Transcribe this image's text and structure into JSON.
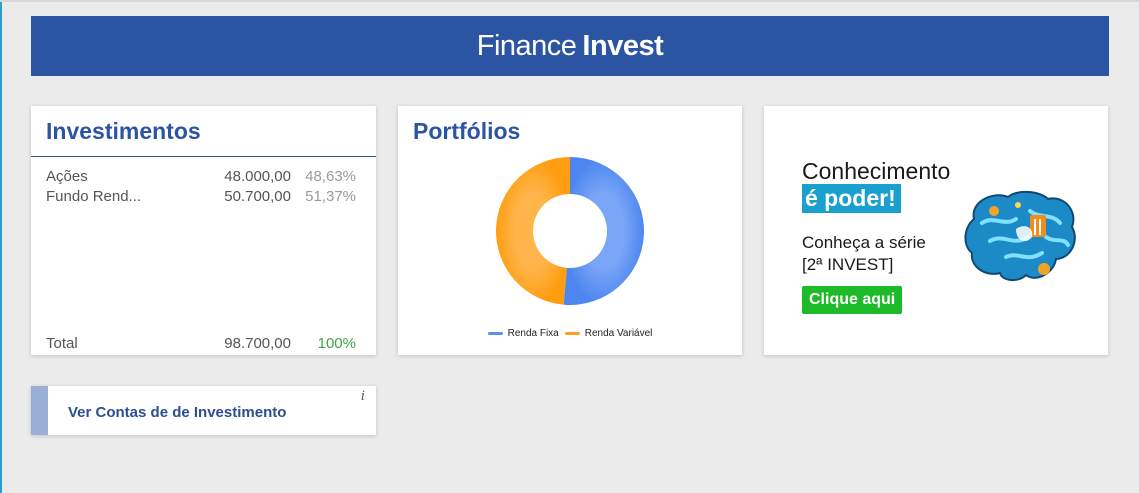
{
  "header": {
    "brand_light": "Finance",
    "brand_bold": "Invest"
  },
  "investments": {
    "title": "Investimentos",
    "rows": [
      {
        "name": "Ações",
        "value": "48.000,00",
        "pct": "48,63%"
      },
      {
        "name": "Fundo Rend...",
        "value": "50.700,00",
        "pct": "51,37%"
      }
    ],
    "total": {
      "name": "Total",
      "value": "98.700,00",
      "pct": "100%"
    }
  },
  "portfolios": {
    "title": "Portfólios",
    "legend": [
      {
        "label": "Renda Fixa",
        "color": "#5b8ff0"
      },
      {
        "label": "Renda Variável",
        "color": "#ffa11f"
      }
    ],
    "chart_data": {
      "type": "pie",
      "categories": [
        "Renda Fixa",
        "Renda Variável"
      ],
      "values": [
        51.37,
        48.63
      ],
      "donut": true,
      "legend": "bottom"
    }
  },
  "ad": {
    "line1": "Conhecimento",
    "line2": "é poder!",
    "line3": "Conheça a série",
    "line4": "[2ª INVEST]",
    "cta": "Clique aqui",
    "image_icon": "brain-icon",
    "colors": {
      "highlight": "#1aa0cf",
      "cta": "#1dbb29"
    }
  },
  "accounts_link": {
    "label": "Ver Contas de de Investimento",
    "info": "i"
  },
  "colors": {
    "brand": "#2b54a3",
    "background": "#ebebeb"
  }
}
